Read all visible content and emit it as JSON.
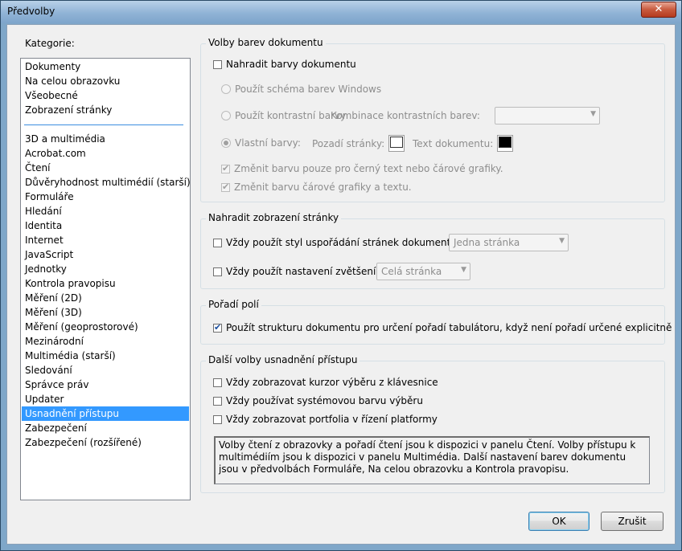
{
  "window": {
    "title": "Předvolby",
    "close_glyph": "✕"
  },
  "categories": {
    "label": "Kategorie:",
    "top_items": [
      "Dokumenty",
      "Na celou obrazovku",
      "Všeobecné",
      "Zobrazení stránky"
    ],
    "items": [
      "3D a multimédia",
      "Acrobat.com",
      "Čtení",
      "Důvěryhodnost multimédií (starší)",
      "Formuláře",
      "Hledání",
      "Identita",
      "Internet",
      "JavaScript",
      "Jednotky",
      "Kontrola pravopisu",
      "Měření (2D)",
      "Měření (3D)",
      "Měření (geoprostorové)",
      "Mezinárodní",
      "Multimédia (starší)",
      "Sledování",
      "Správce práv",
      "Updater",
      "Usnadnění přístupu",
      "Zabezpečení",
      "Zabezpečení (rozšířené)"
    ],
    "selected": "Usnadnění přístupu"
  },
  "doc_colors": {
    "title": "Volby barev dokumentu",
    "replace_label": "Nahradit barvy dokumentu",
    "replace_checked": false,
    "windows_scheme": "Použít schéma barev Windows",
    "high_contrast": "Použít kontrastní barvy",
    "contrast_combo_label": "Kombinace kontrastních barev:",
    "contrast_combo_value": "",
    "custom_colors": "Vlastní barvy:",
    "page_bg_label": "Pozadí stránky:",
    "page_bg_color": "#ffffff",
    "doc_text_label": "Text dokumentu:",
    "doc_text_color": "#000000",
    "only_black_text": "Změnit barvu pouze pro černý text nebo čárové grafiky.",
    "line_art": "Změnit barvu čárové grafiky a textu."
  },
  "page_display": {
    "title": "Nahradit zobrazení stránky",
    "layout_label": "Vždy použít styl uspořádání stránek dokumentu",
    "layout_value": "Jedna stránka",
    "zoom_label": "Vždy použít nastavení zvětšení",
    "zoom_value": "Celá stránka"
  },
  "tab_order": {
    "title": "Pořadí polí",
    "label": "Použít strukturu dokumentu pro určení pořadí tabulátoru, když není pořadí určené explicitně",
    "checked": true
  },
  "other": {
    "title": "Další volby usnadnění přístupu",
    "keyboard_cursor": "Vždy zobrazovat kurzor výběru z klávesnice",
    "system_color": "Vždy používat systémovou barvu výběru",
    "portfolios": "Vždy zobrazovat portfolia v řízení platformy",
    "note": "Volby čtení z obrazovky a pořadí čtení jsou k dispozici v panelu Čtení. Volby přístupu k multimédiím jsou k dispozici v panelu Multimédia. Další nastavení barev dokumentu jsou v předvolbách Formuláře, Na celou obrazovku a Kontrola pravopisu."
  },
  "buttons": {
    "ok": "OK",
    "cancel": "Zrušit"
  }
}
